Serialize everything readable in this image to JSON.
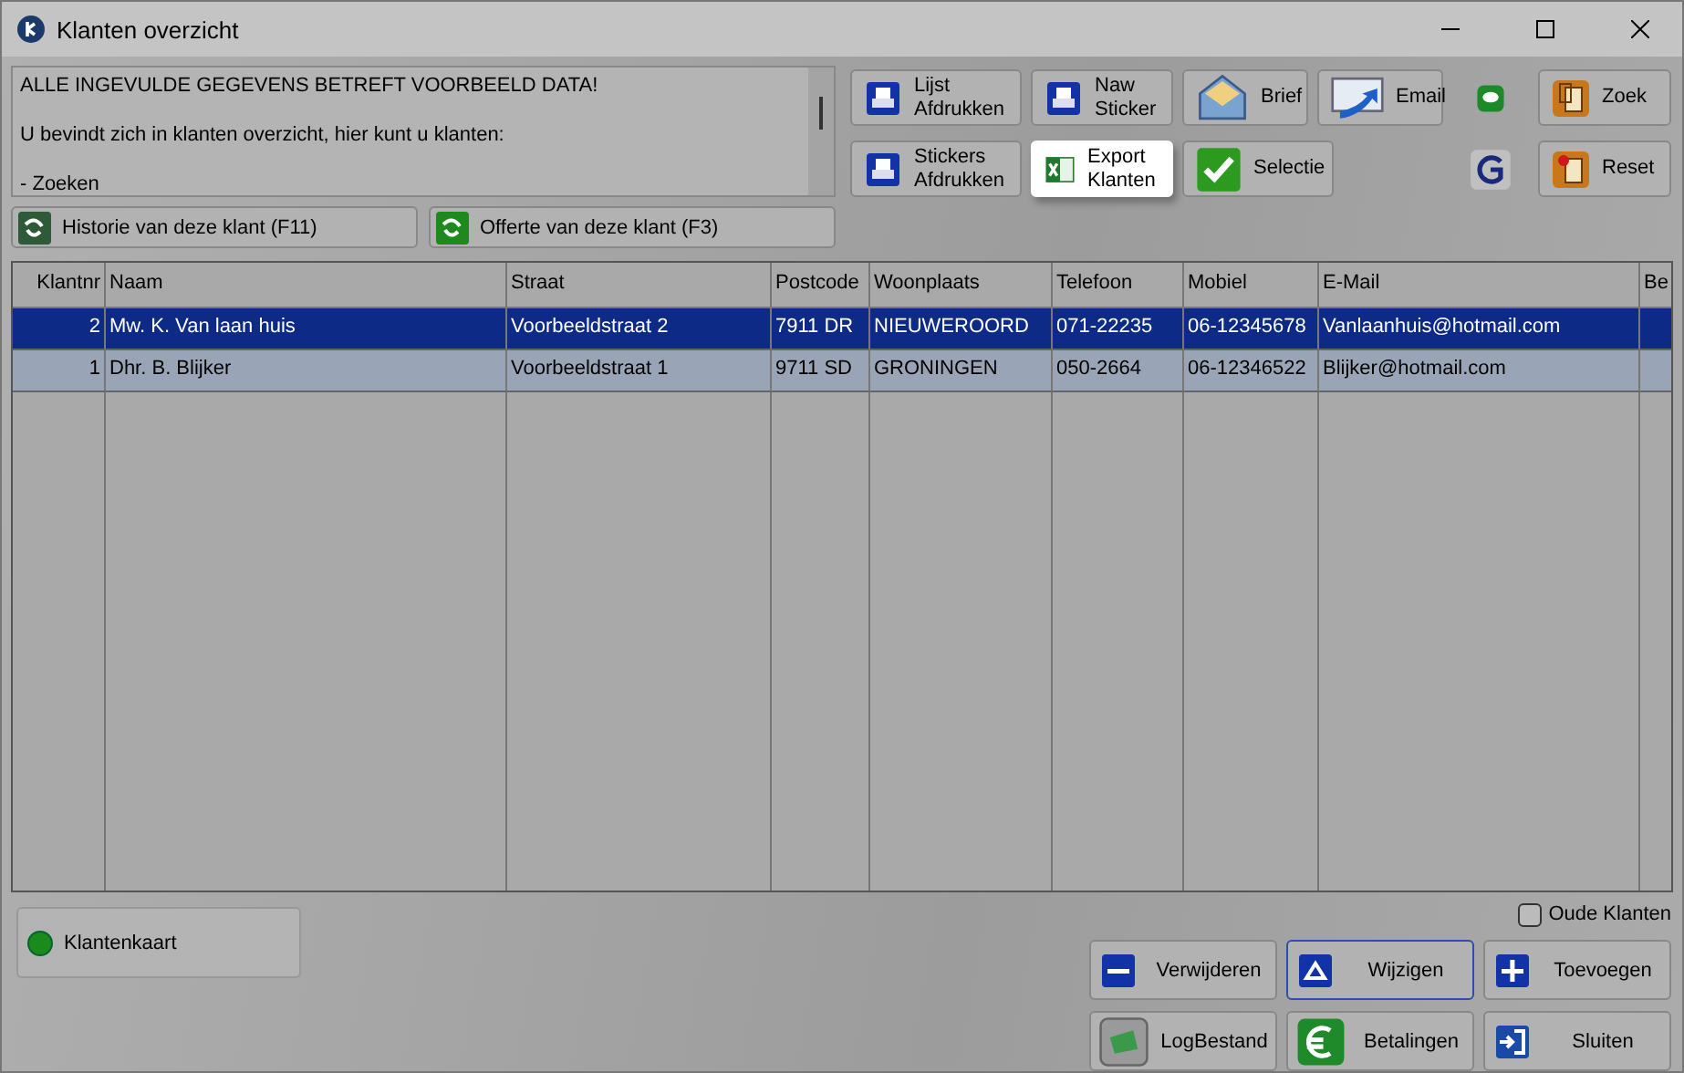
{
  "window": {
    "title": "Klanten overzicht"
  },
  "memo": {
    "lines": [
      "ALLE INGEVULDE GEGEVENS BETREFT VOORBEELD DATA!",
      "U bevindt zich in klanten overzicht, hier kunt u klanten:",
      "- Zoeken"
    ]
  },
  "history_buttons": [
    {
      "label": "Historie van deze klant (F11)"
    },
    {
      "label": "Offerte van deze klant (F3)"
    }
  ],
  "toolbar": [
    {
      "label": "Lijst\nAfdrukken",
      "focused": false
    },
    {
      "label": "Naw\nSticker",
      "focused": false
    },
    {
      "label": "Brief",
      "focused": false
    },
    {
      "label": "Email",
      "focused": false
    },
    {
      "focused": false
    },
    {
      "label": "Zoek",
      "focused": false
    },
    {
      "label": "Stickers\nAfdrukken",
      "focused": false
    },
    {
      "label": "Export\nKlanten",
      "focused": true
    },
    {
      "label": "Selectie",
      "focused": false
    },
    {
      "focused": false
    },
    {
      "label": "Reset",
      "focused": false
    }
  ],
  "table": {
    "columns": [
      "Klantnr",
      "Naam",
      "Straat",
      "Postcode",
      "Woonplaats",
      "Telefoon",
      "Mobiel",
      "E-Mail",
      "Be"
    ],
    "rows": [
      {
        "selected": true,
        "cells": [
          "2",
          "Mw. K. Van  laan huis",
          "Voorbeeldstraat 2",
          "7911 DR",
          "NIEUWEROORD",
          "071-22235",
          "06-12345678",
          "Vanlaanhuis@hotmail.com",
          ""
        ]
      },
      {
        "selected": false,
        "cells": [
          "1",
          "Dhr. B. Blijker",
          "Voorbeeldstraat 1",
          "9711 SD",
          "GRONINGEN",
          "050-2664",
          "06-12346522",
          "Blijker@hotmail.com",
          ""
        ]
      }
    ]
  },
  "card_button": {
    "label": "Klantenkaart"
  },
  "old_customers": {
    "label": "Oude Klanten",
    "checked": false
  },
  "actions": [
    {
      "label": "Verwijderen",
      "focused": false
    },
    {
      "label": "Wijzigen",
      "focused": true
    },
    {
      "label": "Toevoegen",
      "focused": false
    },
    {
      "label": "LogBestand",
      "focused": false
    },
    {
      "label": "Betalingen",
      "focused": false
    },
    {
      "label": "Sluiten",
      "focused": false
    }
  ]
}
